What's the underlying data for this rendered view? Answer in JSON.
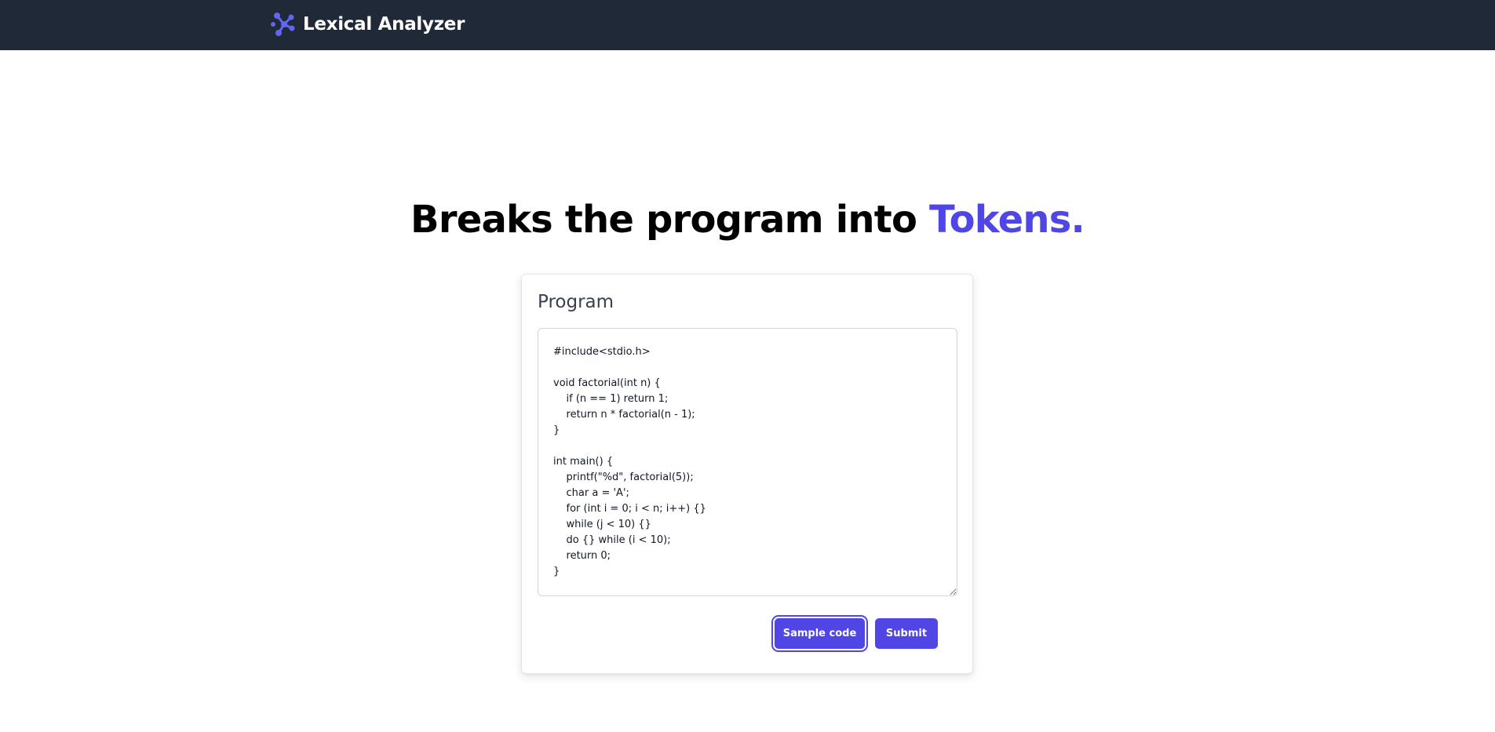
{
  "navbar": {
    "brand_icon": "lexer-logo-icon",
    "brand_name": "Lexical Analyzer",
    "background_color": "#1f2937"
  },
  "hero": {
    "title_prefix": "Breaks the program into ",
    "title_accent": "Tokens.",
    "accent_color": "#4f46e5"
  },
  "program_card": {
    "heading": "Program",
    "code": "#include<stdio.h>\n\nvoid factorial(int n) {\n    if (n == 1) return 1;\n    return n * factorial(n - 1);\n}\n\nint main() {\n    printf(\"%d\", factorial(5));\n    char a = 'A';\n    for (int i = 0; i < n; i++) {}\n    while (j < 10) {}\n    do {} while (i < 10);\n    return 0;\n}",
    "sample_button_label": "Sample code",
    "submit_button_label": "Submit",
    "button_color": "#4f46e5"
  }
}
